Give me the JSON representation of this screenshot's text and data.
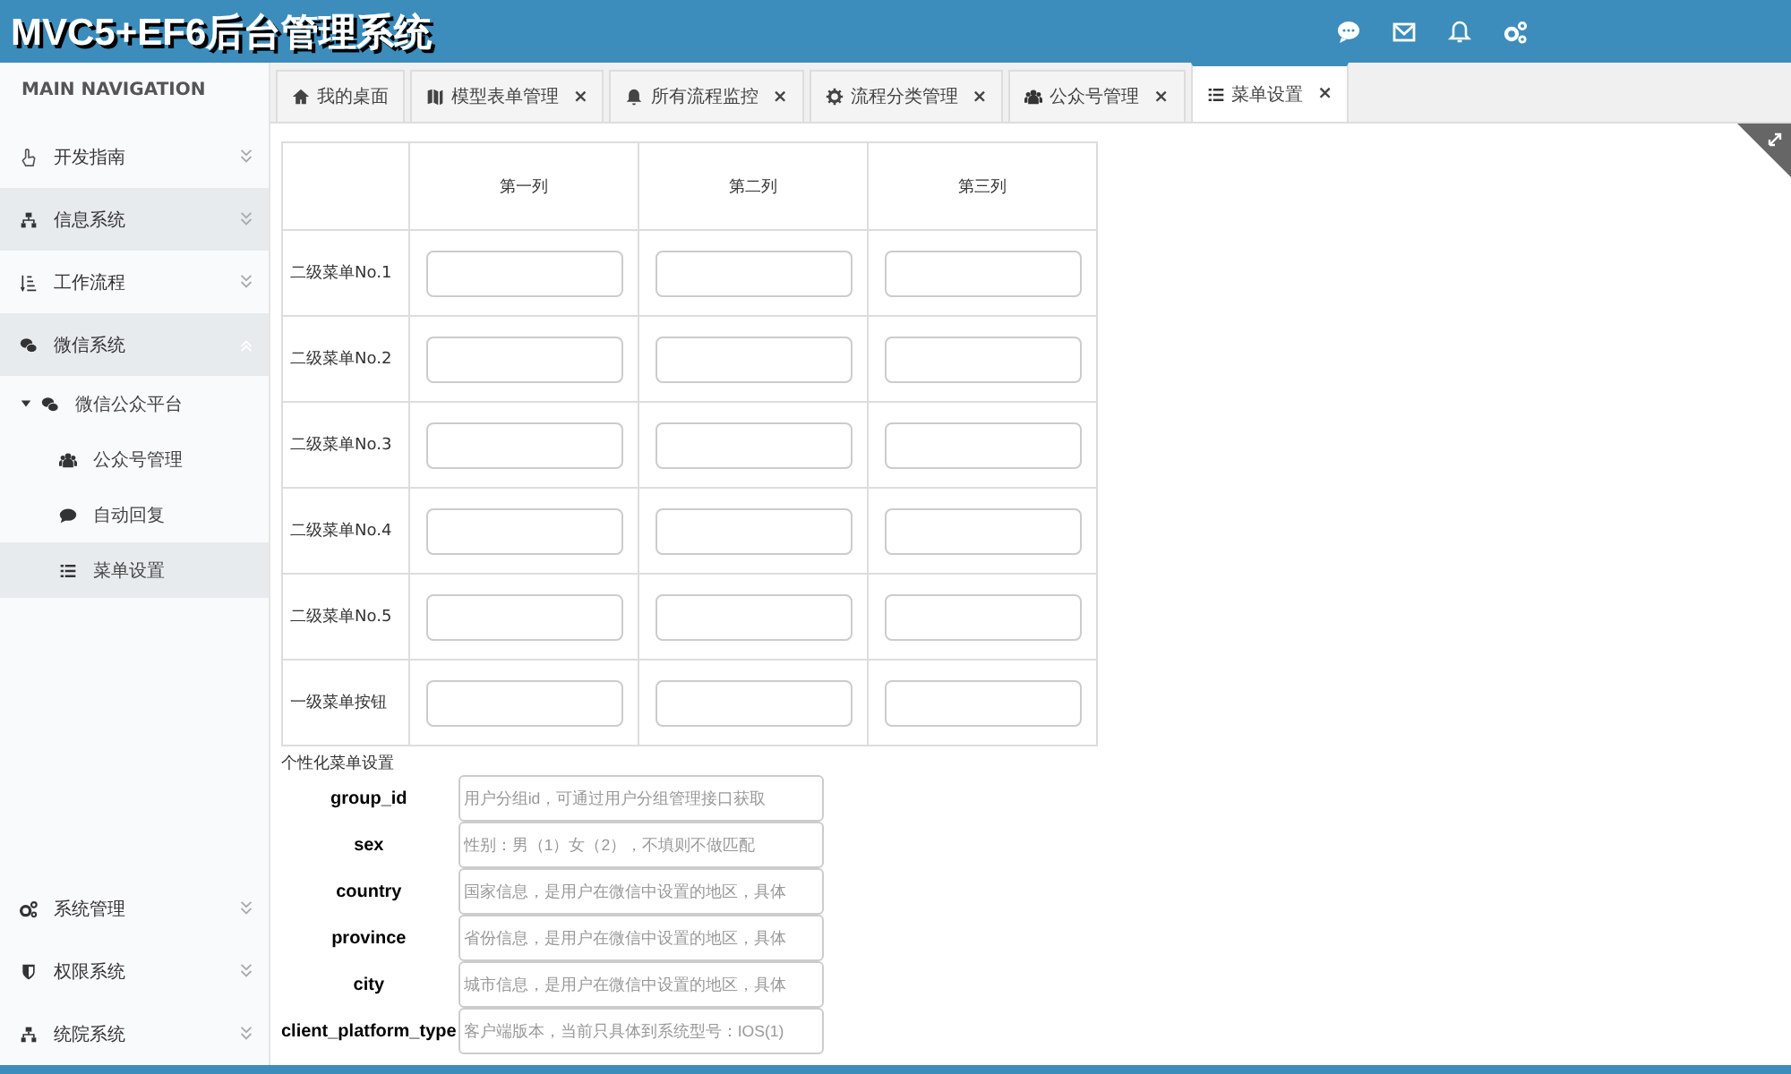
{
  "header": {
    "title": "MVC5+EF6后台管理系统"
  },
  "sidebar": {
    "heading": "MAIN NAVIGATION",
    "items": [
      {
        "label": "开发指南",
        "shaded": false,
        "expanded": false
      },
      {
        "label": "信息系统",
        "shaded": true,
        "expanded": false
      },
      {
        "label": "工作流程",
        "shaded": false,
        "expanded": false
      },
      {
        "label": "微信系统",
        "shaded": true,
        "expanded": true,
        "children": [
          {
            "label": "微信公众平台",
            "expanded": true,
            "children": [
              {
                "label": "公众号管理",
                "selected": false
              },
              {
                "label": "自动回复",
                "selected": false
              },
              {
                "label": "菜单设置",
                "selected": true
              }
            ]
          }
        ]
      }
    ],
    "bottom_items": [
      {
        "label": "系统管理",
        "shaded": false,
        "expanded": false
      },
      {
        "label": "权限系统",
        "shaded": false,
        "expanded": false
      },
      {
        "label": "统院系统",
        "shaded": false,
        "expanded": false
      }
    ]
  },
  "tabs": [
    {
      "label": "我的桌面",
      "closable": false,
      "selected": false
    },
    {
      "label": "模型表单管理",
      "closable": true,
      "selected": false
    },
    {
      "label": "所有流程监控",
      "closable": true,
      "selected": false
    },
    {
      "label": "流程分类管理",
      "closable": true,
      "selected": false
    },
    {
      "label": "公众号管理",
      "closable": true,
      "selected": false
    },
    {
      "label": "菜单设置",
      "closable": true,
      "selected": true
    }
  ],
  "close_mark": "×",
  "menu_table": {
    "columns": [
      "第一列",
      "第二列",
      "第三列"
    ],
    "rows": [
      "二级菜单No.1",
      "二级菜单No.2",
      "二级菜单No.3",
      "二级菜单No.4",
      "二级菜单No.5",
      "一级菜单按钮"
    ]
  },
  "personalized": {
    "title": "个性化菜单设置",
    "fields": [
      {
        "label": "group_id",
        "placeholder": "用户分组id，可通过用户分组管理接口获取"
      },
      {
        "label": "sex",
        "placeholder": "性别：男（1）女（2），不填则不做匹配"
      },
      {
        "label": "country",
        "placeholder": "国家信息，是用户在微信中设置的地区，具体"
      },
      {
        "label": "province",
        "placeholder": "省份信息，是用户在微信中设置的地区，具体"
      },
      {
        "label": "city",
        "placeholder": "城市信息，是用户在微信中设置的地区，具体"
      },
      {
        "label": "client_platform_type",
        "placeholder": "客户端版本，当前只具体到系统型号：IOS(1)"
      }
    ]
  }
}
